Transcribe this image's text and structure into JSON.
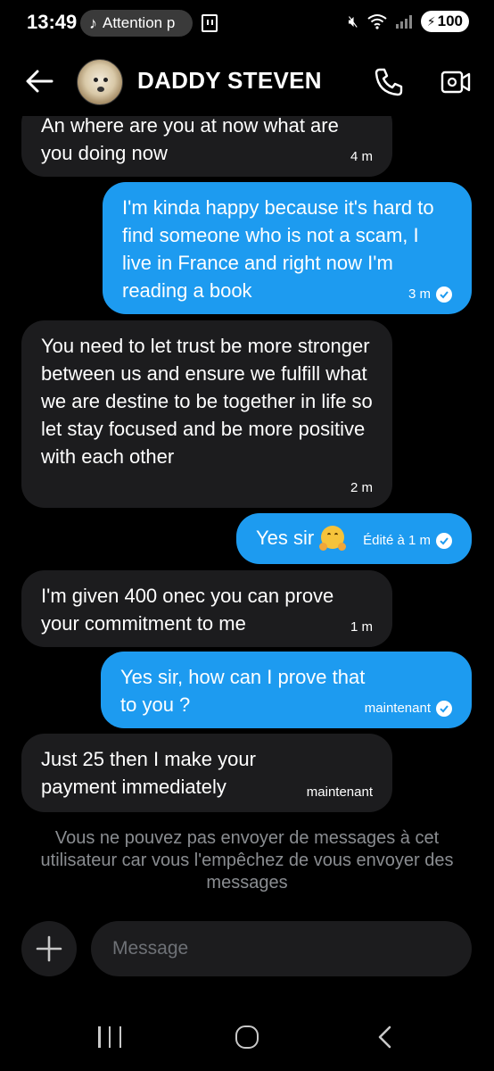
{
  "status_bar": {
    "time": "13:49",
    "notification_text": "Attention p",
    "battery": "100"
  },
  "header": {
    "contact_name": "DADDY STEVEN"
  },
  "messages": [
    {
      "direction": "in",
      "text": "An where are you at now what are you doing now",
      "time": "4 m"
    },
    {
      "direction": "out",
      "text": "I'm kinda happy because it's hard to find someone who is not a scam, I live in France and right now I'm reading a book",
      "time": "3 m",
      "seen": true
    },
    {
      "direction": "in",
      "text": "You need to let trust be more stronger between us and ensure we fulfill what we are destine to be together in life so let stay focused and be more positive with each other",
      "time": "2 m"
    },
    {
      "direction": "out",
      "text": "Yes sir",
      "emoji": "hugging-face",
      "time": "Édité à 1 m",
      "seen": true
    },
    {
      "direction": "in",
      "text": "I'm given 400 onec you can prove your commitment to me",
      "time": "1 m"
    },
    {
      "direction": "out",
      "text": "Yes sir, how can I prove that to you ?",
      "time": "maintenant",
      "seen": true
    },
    {
      "direction": "in",
      "text": "Just 25 then I make your payment immediately",
      "time": "maintenant"
    }
  ],
  "notice": "Vous ne pouvez pas envoyer de messages à cet utilisateur car vous l'empêchez de vous envoyer des messages",
  "composer": {
    "placeholder": "Message"
  },
  "colors": {
    "outgoing_bubble": "#1d9bf0",
    "incoming_bubble": "#1c1c1e",
    "background": "#000000"
  }
}
